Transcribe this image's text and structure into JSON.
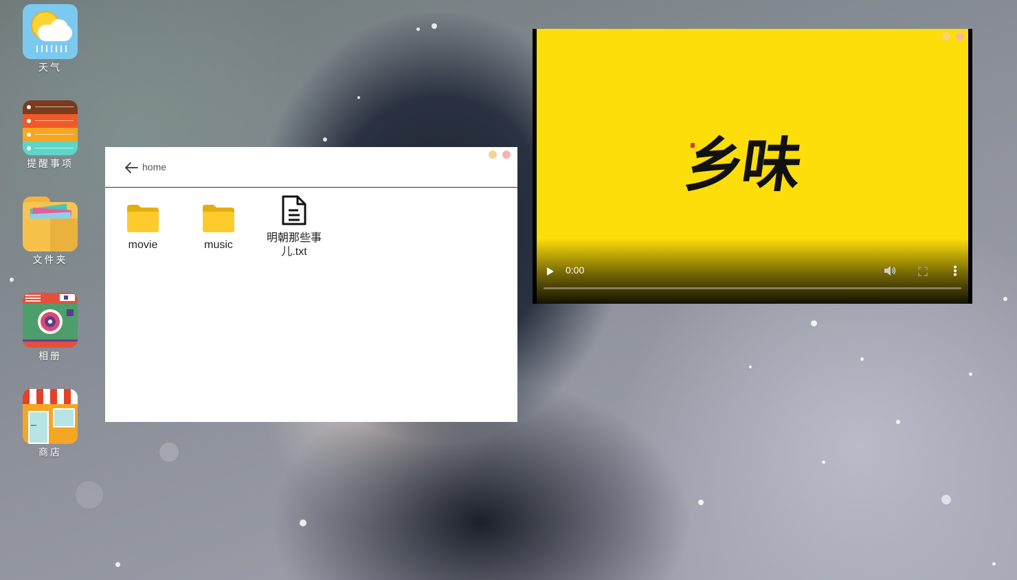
{
  "desktop": {
    "icons": [
      {
        "label": "天气",
        "icon": "weather-icon"
      },
      {
        "label": "提醒事项",
        "icon": "reminders-icon"
      },
      {
        "label": "文件夹",
        "icon": "folder-icon"
      },
      {
        "label": "相册",
        "icon": "camera-icon"
      },
      {
        "label": "商店",
        "icon": "store-icon"
      }
    ]
  },
  "file_manager": {
    "path": "home",
    "items": [
      {
        "name": "movie",
        "type": "folder"
      },
      {
        "name": "music",
        "type": "folder"
      },
      {
        "name": "明朝那些事儿.txt",
        "type": "text-file"
      }
    ]
  },
  "video_player": {
    "title_art": "乡味",
    "current_time": "0:00",
    "progress": 0
  },
  "colors": {
    "window_minimize": "#f5d58a",
    "window_close": "#f7b3b3",
    "folder": "#fdcb2b",
    "video_background": "#fddd0a"
  }
}
